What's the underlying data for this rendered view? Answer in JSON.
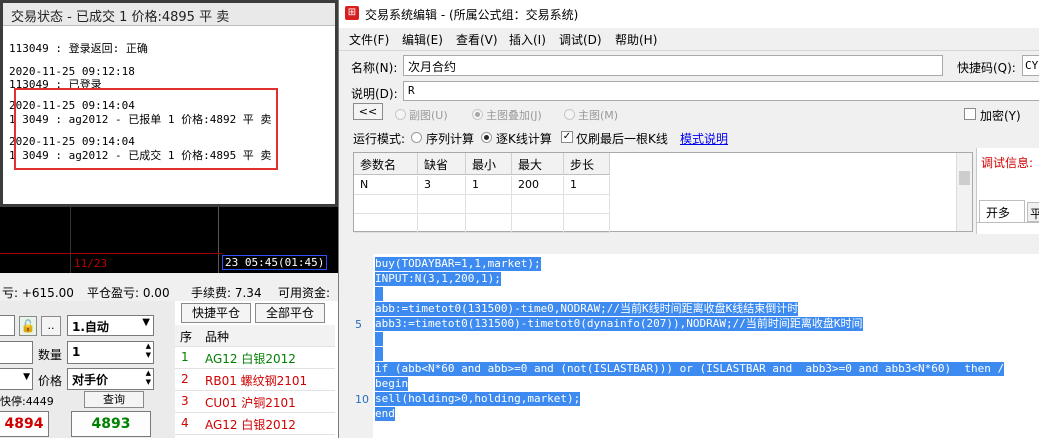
{
  "chart": {
    "date_label": "11/23",
    "time_label": "23 05:45(01:45)"
  },
  "pnl_bar": {
    "float_pnl": "亏: +615.00",
    "close_pnl": "平仓盈亏: 0.00",
    "fee": "手续费: 7.34",
    "avail": "可用资金:"
  },
  "order_panel": {
    "auto_label": "1.自动",
    "dotdot": "..",
    "qty_label": "数量",
    "qty_value": "1",
    "price_label": "价格",
    "price_value": "对手价",
    "fast_label": "快停:4449",
    "query_label": "查询",
    "bid_price": "4894",
    "ask_price": "4893"
  },
  "right_list": {
    "quick_close": "快捷平仓",
    "close_all": "全部平仓",
    "col_seq": "序",
    "col_name": "品种",
    "rows": [
      {
        "seq": "1",
        "name": "AG12 白银2012",
        "color": "#008000"
      },
      {
        "seq": "2",
        "name": "RB01 螺纹钢2101",
        "color": "#d00000"
      },
      {
        "seq": "3",
        "name": "CU01 沪铜2101",
        "color": "#d00000"
      },
      {
        "seq": "4",
        "name": "AG12 白银2012",
        "color": "#d00000"
      }
    ]
  },
  "status_window": {
    "title": "交易状态 - 已成交 1 价格:4895 平 卖",
    "log": [
      "113049 : 登录返回: 正确",
      "",
      "2020-11-25 09:12:18",
      "113049 : 已登录",
      "",
      "2020-11-25 09:14:04",
      "1 3049 : ag2012 - 已报单 1 价格:4892 平 卖",
      "",
      "2020-11-25 09:14:04",
      "1 3049 : ag2012 - 已成交 1 价格:4895 平 卖"
    ]
  },
  "editor": {
    "title": "交易系统编辑 - (所属公式组：交易系统)",
    "menu": [
      "文件(F)",
      "编辑(E)",
      "查看(V)",
      "插入(I)",
      "调试(D)",
      "帮助(H)"
    ],
    "name_label": "名称(N):",
    "name_value": "次月合约",
    "shortcut_label": "快捷码(Q):",
    "shortcut_value": "CY",
    "desc_label": "说明(D):",
    "desc_value": "R",
    "collapse_button": "<<",
    "chart_modes": [
      "副图(U)",
      "主图叠加(J)",
      "主图(M)"
    ],
    "encrypt_label": "加密(Y)",
    "run_mode_label": "运行模式:",
    "run_modes": [
      "序列计算",
      "逐K线计算"
    ],
    "last_bar_only": "仅刷最后一根K线",
    "mode_help": "模式说明",
    "debug_label": "调试信息:",
    "debug_tabs": [
      "开多",
      "平"
    ],
    "params": {
      "headers": [
        "参数名",
        "缺省",
        "最小",
        "最大",
        "步长"
      ],
      "rows": [
        [
          "N",
          "3",
          "1",
          "200",
          "1"
        ]
      ]
    },
    "code_lines": [
      "buy(TODAYBAR=1,1,market);",
      "INPUT:N(3,1,200,1);",
      "",
      "abb:=timetot0(131500)-time0,NODRAW;//当前K线时间距离收盘K线结束倒计时",
      "abb3:=timetot0(131500)-timetot0(dynainfo(207)),NODRAW;//当前时间距离收盘K时间",
      "",
      "",
      "if (abb<N*60 and abb>=0 and (not(ISLASTBAR))) or (ISLASTBAR and  abb3>=0 and abb3<N*60)  then /",
      "begin",
      "sell(holding>0,holding,market);",
      "end"
    ],
    "line_numbers": [
      "5",
      "10"
    ]
  },
  "colors": {
    "selection": "#3d8bf0",
    "link": "#0000ee",
    "debug_red": "#d00000",
    "redbox": "#e03030"
  }
}
